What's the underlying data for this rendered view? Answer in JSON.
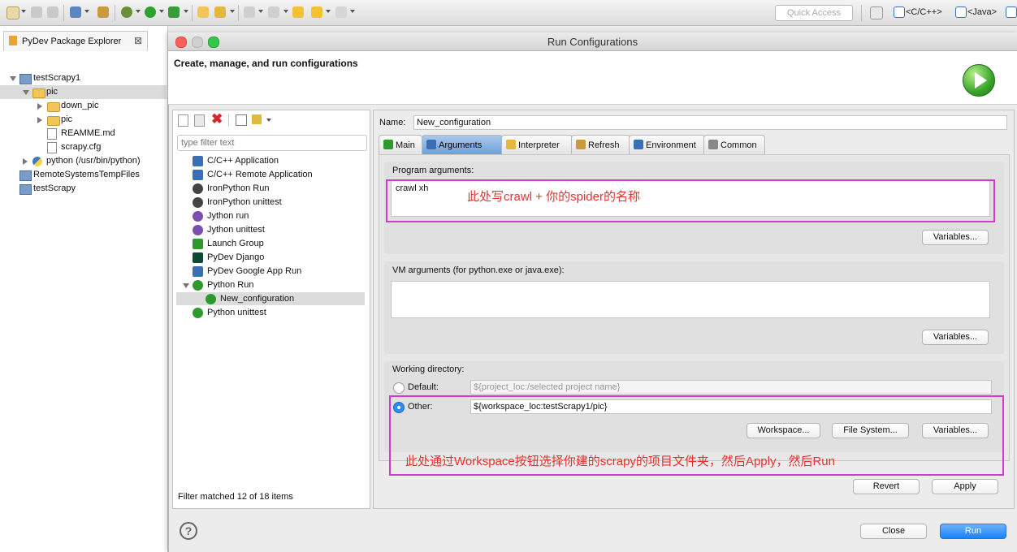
{
  "toolbar": {
    "quick_access_placeholder": "Quick Access",
    "perspective_cpp": "<C/C++>",
    "perspective_java": "<Java>"
  },
  "explorer": {
    "tab_label": "PyDev Package Explorer",
    "tree": [
      {
        "label": "testScrapy1",
        "depth": 0,
        "expanded": true,
        "kind": "project"
      },
      {
        "label": "pic",
        "depth": 1,
        "expanded": true,
        "kind": "folder",
        "selected": true
      },
      {
        "label": "down_pic",
        "depth": 2,
        "expanded": false,
        "kind": "folder"
      },
      {
        "label": "pic",
        "depth": 2,
        "expanded": false,
        "kind": "folder"
      },
      {
        "label": "REAMME.md",
        "depth": 2,
        "kind": "file"
      },
      {
        "label": "scrapy.cfg",
        "depth": 2,
        "kind": "file"
      },
      {
        "label": "python  (/usr/bin/python)",
        "depth": 1,
        "expanded": false,
        "kind": "python"
      },
      {
        "label": "RemoteSystemsTempFiles",
        "depth": 0,
        "kind": "project"
      },
      {
        "label": "testScrapy",
        "depth": 0,
        "kind": "project"
      }
    ]
  },
  "dialog": {
    "title": "Run Configurations",
    "header_title": "Create, manage, and run configurations",
    "filter_placeholder": "type filter text",
    "config_types": [
      {
        "label": "C/C++ Application",
        "icon": "c-app-icon",
        "color": "#3b6fb5"
      },
      {
        "label": "C/C++ Remote Application",
        "icon": "c-remote-icon",
        "color": "#3b6fb5"
      },
      {
        "label": "IronPython Run",
        "icon": "ironpython-run-icon",
        "color": "#444444"
      },
      {
        "label": "IronPython unittest",
        "icon": "ironpython-unittest-icon",
        "color": "#444444"
      },
      {
        "label": "Jython run",
        "icon": "jython-run-icon",
        "color": "#7b4fb0"
      },
      {
        "label": "Jython unittest",
        "icon": "jython-unittest-icon",
        "color": "#7b4fb0"
      },
      {
        "label": "Launch Group",
        "icon": "launch-group-icon",
        "color": "#2e9a2e"
      },
      {
        "label": "PyDev Django",
        "icon": "django-icon",
        "color": "#0c4b33"
      },
      {
        "label": "PyDev Google App Run",
        "icon": "google-app-icon",
        "color": "#3b6fb5"
      },
      {
        "label": "Python Run",
        "icon": "python-run-icon",
        "color": "#2e9a2e"
      },
      {
        "label": "New_configuration",
        "icon": "python-config-icon",
        "color": "#2e9a2e"
      },
      {
        "label": "Python unittest",
        "icon": "python-unittest-icon",
        "color": "#2e9a2e"
      }
    ],
    "filter_status": "Filter matched 12 of 18 items",
    "name_label": "Name:",
    "name_value": "New_configuration",
    "tabs": [
      {
        "label": "Main",
        "active": false
      },
      {
        "label": "Arguments",
        "active": true
      },
      {
        "label": "Interpreter",
        "active": false
      },
      {
        "label": "Refresh",
        "active": false
      },
      {
        "label": "Environment",
        "active": false
      },
      {
        "label": "Common",
        "active": false
      }
    ],
    "program_args_label": "Program arguments:",
    "program_args_value": "crawl xh",
    "vm_args_label": "VM arguments (for python.exe or java.exe):",
    "vm_args_value": "",
    "variables_label": "Variables...",
    "working_dir_label": "Working directory:",
    "default_label": "Default:",
    "default_value": "${project_loc:/selected project name}",
    "other_label": "Other:",
    "other_value": "${workspace_loc:testScrapy1/pic}",
    "workspace_label": "Workspace...",
    "filesystem_label": "File System...",
    "revert_label": "Revert",
    "apply_label": "Apply",
    "close_label": "Close",
    "run_label": "Run",
    "help_label": "?"
  },
  "annotations": {
    "args_note": "此处写crawl +  你的spider的名称",
    "workdir_note": "此处通过Workspace按钮选择你建的scrapy的项目文件夹，然后Apply，然后Run",
    "highlight_color": "#d23ad0",
    "note_color": "#e8322e"
  }
}
